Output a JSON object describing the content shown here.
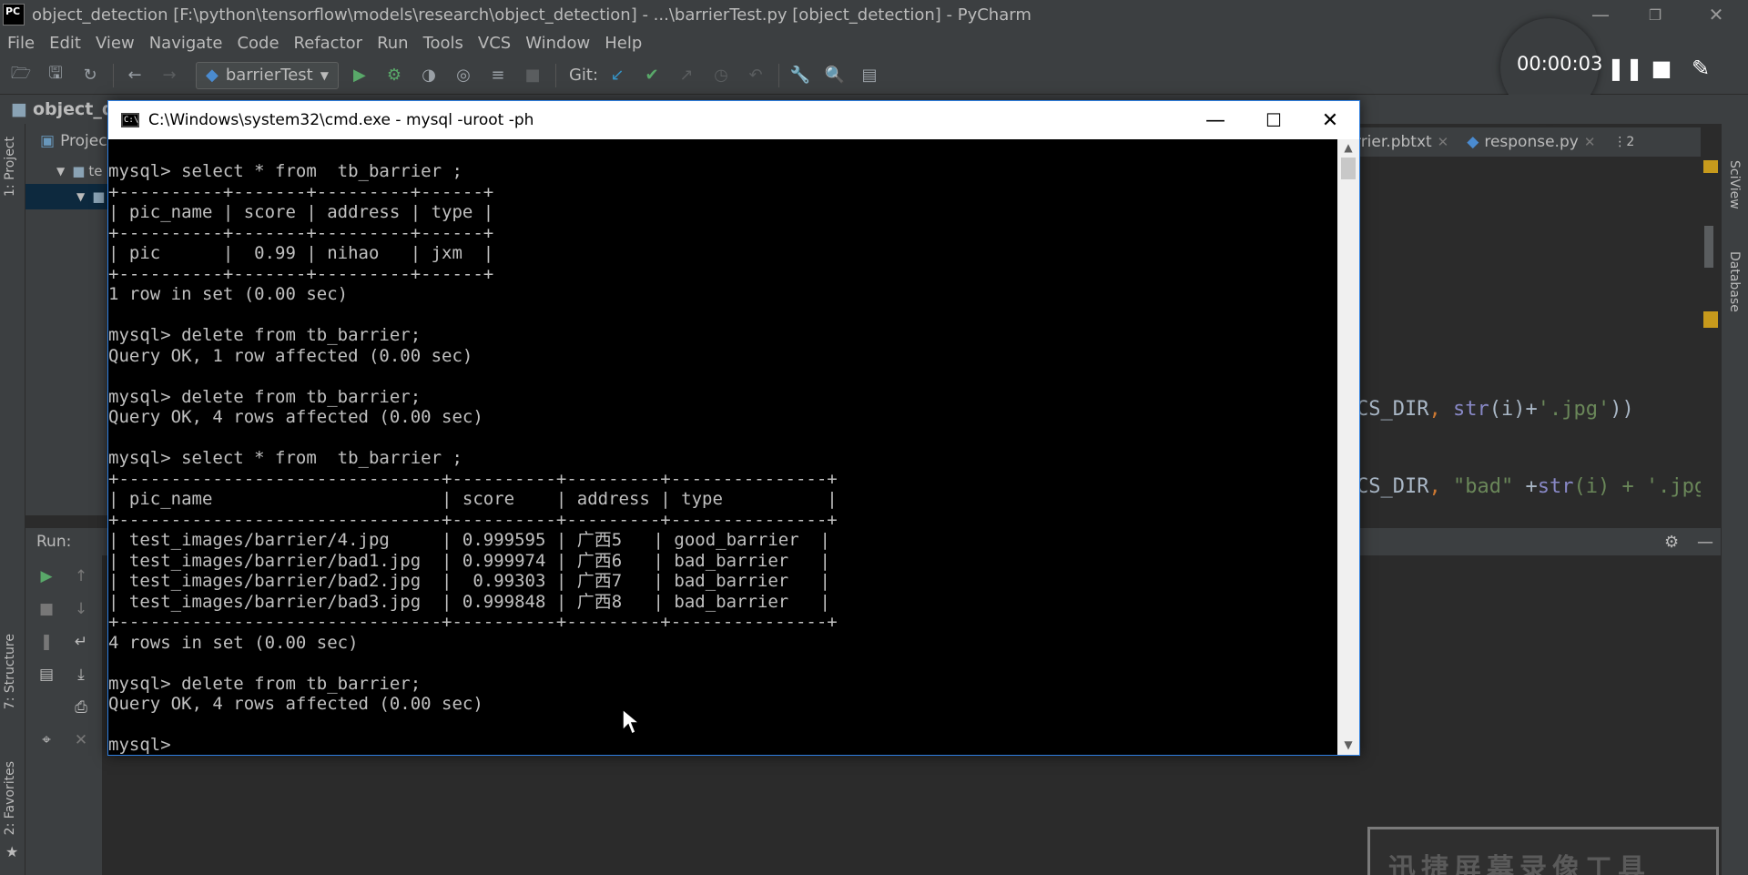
{
  "window": {
    "title": "object_detection [F:\\python\\tensorflow\\models\\research\\object_detection] - ...\\barrierTest.py [object_detection] - PyCharm",
    "logo": "PC"
  },
  "menu": [
    "File",
    "Edit",
    "View",
    "Navigate",
    "Code",
    "Refactor",
    "Run",
    "Tools",
    "VCS",
    "Window",
    "Help"
  ],
  "toolbar": {
    "run_config": "barrierTest",
    "git_label": "Git:"
  },
  "recorder": {
    "time": "00:00:03"
  },
  "nav": {
    "project_name": "object_de"
  },
  "left_tabs": {
    "project": "1: Project",
    "structure": "7: Structure",
    "favorites": "2: Favorites"
  },
  "project_panel": {
    "header": "Projec",
    "row1": "te"
  },
  "editor": {
    "tabs": [
      {
        "label": "rrier.pbtxt"
      },
      {
        "label": "response.py"
      }
    ],
    "tab_menu": "⋮2",
    "code_line1": {
      "a": "CS_DIR",
      "b": ", ",
      "c": "str",
      "d": "(i)+",
      "e": "'.jpg'",
      "f": "))"
    },
    "code_line2": {
      "a": "CS_DIR",
      "b": ", ",
      "c": "\"bad\"",
      "d": " +",
      "e": "str",
      "f": "(i) + '.jpg"
    }
  },
  "right_tabs": {
    "sciview": "SciView",
    "database": "Database"
  },
  "run_panel": {
    "label": "Run:"
  },
  "cmd": {
    "title": "C:\\Windows\\system32\\cmd.exe - mysql  -uroot -ph",
    "lines": [
      "mysql> select * from  tb_barrier ;",
      "+----------+-------+---------+------+",
      "| pic_name | score | address | type |",
      "+----------+-------+---------+------+",
      "| pic      |  0.99 | nihao   | jxm  |",
      "+----------+-------+---------+------+",
      "1 row in set (0.00 sec)",
      "",
      "mysql> delete from tb_barrier;",
      "Query OK, 1 row affected (0.00 sec)",
      "",
      "mysql> delete from tb_barrier;",
      "Query OK, 4 rows affected (0.00 sec)",
      "",
      "mysql> select * from  tb_barrier ;",
      "+-------------------------------+----------+---------+---------------+",
      "| pic_name                      | score    | address | type          |",
      "+-------------------------------+----------+---------+---------------+",
      "| test_images/barrier/4.jpg     | 0.999595 | 广西5   | good_barrier  |",
      "| test_images/barrier/bad1.jpg  | 0.999974 | 广西6   | bad_barrier   |",
      "| test_images/barrier/bad2.jpg  |  0.99303 | 广西7   | bad_barrier   |",
      "| test_images/barrier/bad3.jpg  | 0.999848 | 广西8   | bad_barrier   |",
      "+-------------------------------+----------+---------+---------------+",
      "4 rows in set (0.00 sec)",
      "",
      "mysql> delete from tb_barrier;",
      "Query OK, 4 rows affected (0.00 sec)",
      "",
      "mysql>"
    ]
  },
  "watermark": {
    "text": "迅捷屏幕录像工具"
  },
  "colors": {
    "ide_bg": "#2b2b2b",
    "ide_panel": "#3c3f41",
    "cmd_bg": "#000000",
    "cmd_text": "#c0c0c0",
    "run_green": "#59a869",
    "check_blue": "#3592c4"
  }
}
